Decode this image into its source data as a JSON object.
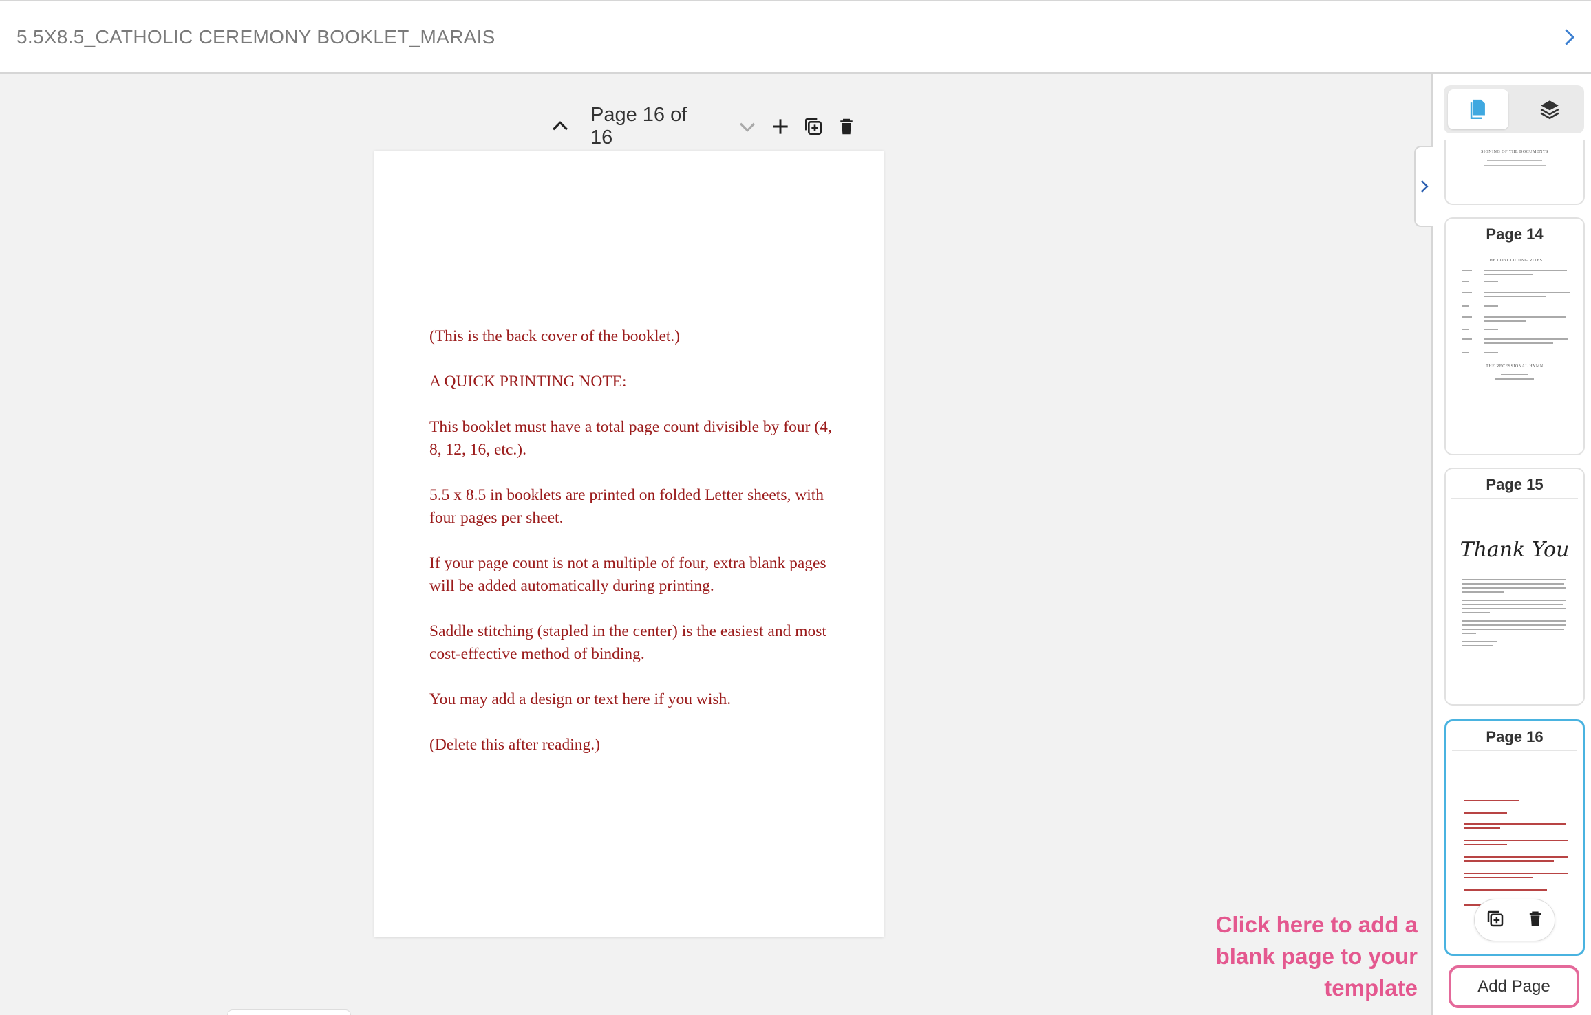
{
  "header": {
    "title": "5.5X8.5_CATHOLIC CEREMONY BOOKLET_MARAIS"
  },
  "toolbar": {
    "page_indicator": "Page 16 of 16"
  },
  "page": {
    "paragraphs": [
      "(This is the back cover of the booklet.)",
      "A QUICK PRINTING NOTE:",
      "This booklet must have a total page count divisible by four (4, 8, 12, 16, etc.).",
      "5.5 x 8.5 in booklets are printed on folded Letter sheets, with four pages per sheet.",
      "If your page count is not a multiple of four, extra blank pages will be added automatically during printing.",
      "Saddle stitching (stapled in the center) is the easiest and most cost-effective method of binding.",
      "You may add a design or text here if you wish.",
      "(Delete this after reading.)"
    ]
  },
  "sidebar": {
    "tabs": [
      "pages",
      "layers"
    ],
    "thumbnails": [
      {
        "label": "",
        "heading": "SIGNING OF THE DOCUMENTS"
      },
      {
        "label": "Page 14",
        "heading": "THE CONCLUDING RITES",
        "subheading": "THE RECESSIONAL HYMN"
      },
      {
        "label": "Page 15",
        "script": "Thank You"
      },
      {
        "label": "Page 16"
      }
    ],
    "add_page_label": "Add Page"
  },
  "callout": {
    "text": "Click here to add a blank page to your template"
  },
  "colors": {
    "accent": "#4ab3e0",
    "callout": "#e4588f",
    "page_text": "#9b1c1c"
  }
}
